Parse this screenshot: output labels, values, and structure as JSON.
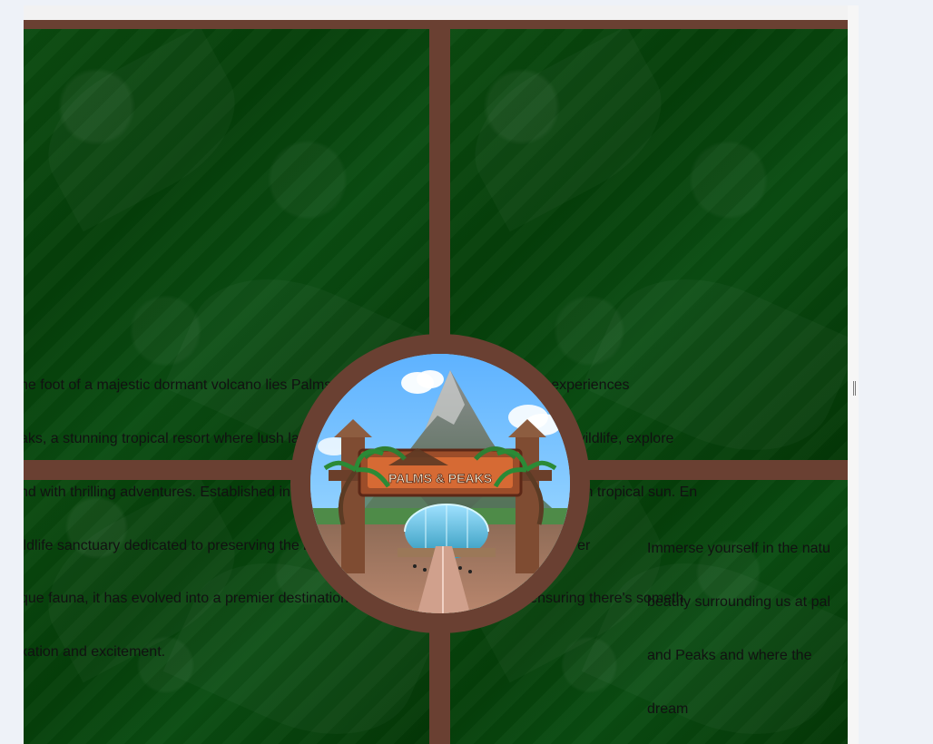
{
  "page": {
    "intro_lines": [
      "he foot of a majestic dormant volcano lies Palms and Peaks, a captivating array of experiences",
      "aks, a stunning tropical resort where lush landscapes wake up to the gentle sounds of wildlife, explore",
      "nd with thrilling adventures. Established in 1993 as a wildlife refuge and bask in the warm tropical sun. En",
      "ildlife sanctuary dedicated to preserving the region's nature-watching spots, and discover",
      "que fauna, it has evolved into a premier destination for every visitor to all ages, ensuring there's someth",
      "xation and excitement."
    ],
    "side_lines": [
      "Immerse yourself in the natu",
      "beauty surrounding us at pal",
      "and Peaks and where the",
      "dream"
    ],
    "logo_text": "PALMS & PEAKS"
  }
}
